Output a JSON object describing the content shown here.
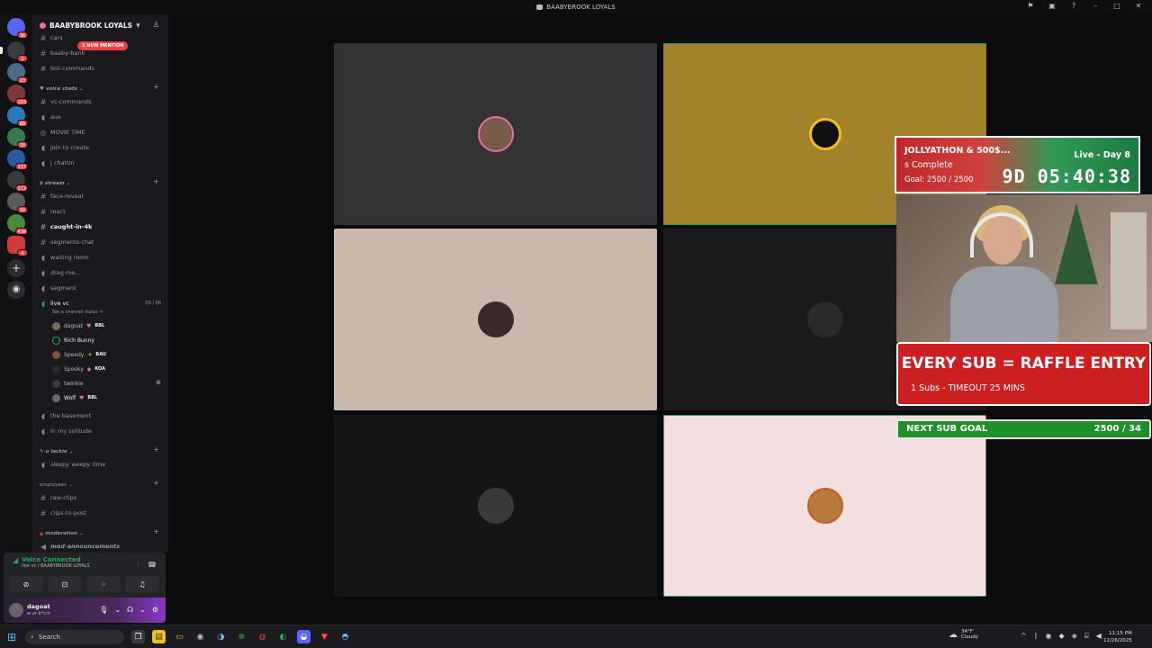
{
  "window": {
    "title": "BAABYBROOK LOYALS"
  },
  "rail": {
    "badges": [
      "36",
      "1",
      "23",
      "193",
      "88",
      "35",
      "237",
      "172",
      "30",
      "436",
      "4"
    ]
  },
  "server": {
    "name": "BAABYBROOK LOYALS",
    "new_mention": "1 NEW MENTION"
  },
  "channels_top": [
    "cars",
    "baaby-bank",
    "bot-commands"
  ],
  "voice_chats": {
    "label": "voice chats",
    "items": [
      "vc-commands",
      "aux",
      "MOVIE TIME",
      "join to create",
      "j chattin"
    ]
  },
  "stream": {
    "label": "stream",
    "items": [
      "face-reveal",
      "react",
      "caught-in-4k",
      "segments-chat",
      "waiting room",
      "drag me...",
      "segment"
    ]
  },
  "live_vc": {
    "name": "live vc",
    "count": "59 / 00",
    "status_hint": "Set a channel status",
    "members": [
      {
        "name": "dagoat",
        "tag": "BBL"
      },
      {
        "name": "Rich Bunny",
        "tag": ""
      },
      {
        "name": "Speedy",
        "tag": "BAU"
      },
      {
        "name": "Spooky",
        "tag": "KOA"
      },
      {
        "name": "twinkie",
        "tag": ""
      },
      {
        "name": "Wolf",
        "tag": "BBL"
      }
    ]
  },
  "channels_after": [
    "the basement",
    "in my solitude"
  ],
  "u_lackin": {
    "label": "u lackin",
    "items": [
      "sleepy weepy time"
    ]
  },
  "employees": {
    "label": "employees",
    "items": [
      "raw-clips",
      "clips-to-post"
    ]
  },
  "moderation": {
    "label": "moderation",
    "items": [
      "mod-announcements"
    ]
  },
  "voice_panel": {
    "connected": "Voice Connected",
    "location": "live vc / BAABYBROOK LOYALS"
  },
  "user": {
    "name": "dagoat",
    "status": "w ur b*tch"
  },
  "overlay": {
    "jolly_title": "JOLLYATHON & 500$...",
    "jolly_sub": "s Complete",
    "jolly_goal": "Goal: 2500 / 2500",
    "live_day": "Live - Day 8",
    "timer": "9D 05:40:38",
    "raffle": "EVERY SUB = RAFFLE ENTRY",
    "raffle_sub": "1 Subs - TIMEOUT 25 MINS",
    "subgoal_label": "NEXT SUB GOAL",
    "subgoal_value": "2500 / 34"
  },
  "taskbar": {
    "search": "Search",
    "weather_temp": "34°F",
    "weather_desc": "Cloudy",
    "time": "11:15 PM",
    "date": "12/26/2025"
  }
}
